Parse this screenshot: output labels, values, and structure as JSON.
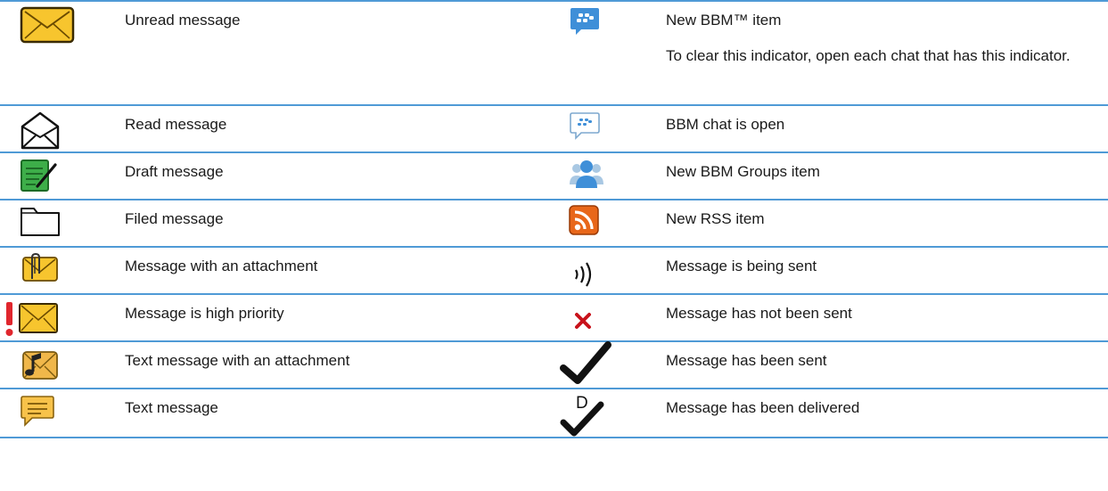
{
  "rows": [
    {
      "left_icon": "unread-envelope-icon",
      "left_label": "Unread message",
      "right_icon": "bbm-new-icon",
      "right_label": "New BBM™ item",
      "right_note": "To clear this indicator, open each chat that has this indicator."
    },
    {
      "left_icon": "read-envelope-icon",
      "left_label": "Read message",
      "right_icon": "bbm-chat-open-icon",
      "right_label": "BBM chat is open"
    },
    {
      "left_icon": "draft-icon",
      "left_label": "Draft message",
      "right_icon": "bbm-groups-icon",
      "right_label": "New BBM Groups item"
    },
    {
      "left_icon": "folder-icon",
      "left_label": "Filed message",
      "right_icon": "rss-icon",
      "right_label": "New RSS item"
    },
    {
      "left_icon": "attachment-envelope-icon",
      "left_label": "Message with an attachment",
      "right_icon": "sending-icon",
      "right_label": "Message is being sent"
    },
    {
      "left_icon": "high-priority-icon",
      "left_label": "Message is high priority",
      "right_icon": "not-sent-icon",
      "right_label": "Message has not been sent"
    },
    {
      "left_icon": "text-attachment-icon",
      "left_label": "Text message with an attachment",
      "right_icon": "sent-check-icon",
      "right_label": "Message has been sent"
    },
    {
      "left_icon": "text-message-icon",
      "left_label": "Text message",
      "right_icon": "delivered-icon",
      "right_label": "Message has been delivered",
      "delivered_letter": "D"
    }
  ],
  "colors": {
    "rule": "#4f9ad6",
    "envelope": "#f7c52e",
    "bbm": "#3f8fd8",
    "rss": "#e8671a",
    "error": "#c8121b",
    "draft": "#3dae49"
  }
}
